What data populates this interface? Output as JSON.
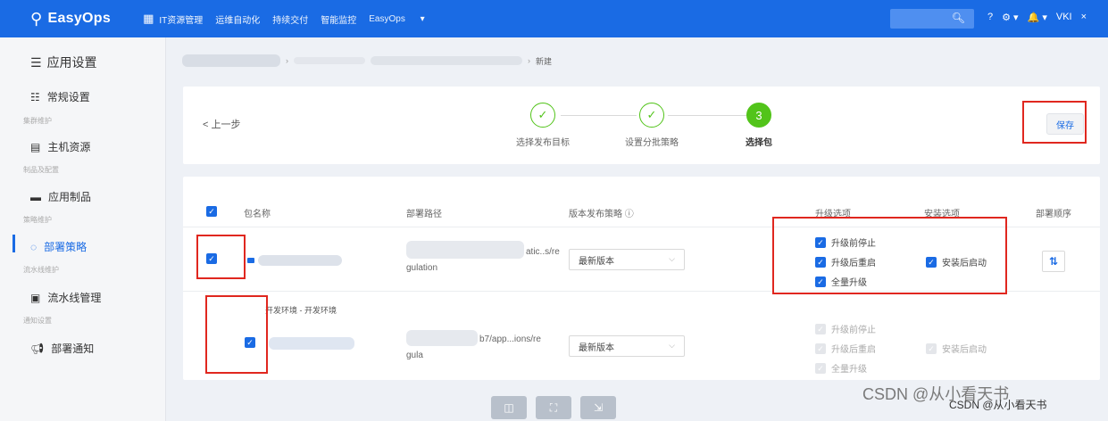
{
  "topbar": {
    "logo": "EasyOps",
    "nav": [
      "IT资源管理",
      "运维自动化",
      "持续交付",
      "智能监控",
      "EasyOps"
    ],
    "tools": [
      "?",
      "⚙",
      "🔔",
      "VKI",
      "×"
    ]
  },
  "sidebar": {
    "title": "应用设置",
    "items": [
      {
        "label": "常规设置",
        "sub": "集群维护"
      },
      {
        "label": "主机资源",
        "sub": "制品及配置"
      },
      {
        "label": "应用制品",
        "sub": "策略维护"
      },
      {
        "label": "部署策略",
        "sub": "流水线维护"
      },
      {
        "label": "流水线管理",
        "sub": "通知设置"
      },
      {
        "label": "部署通知",
        "sub": ""
      }
    ]
  },
  "breadcrumb": {
    "current": "新建"
  },
  "steps": {
    "prev_label": "< 上一步",
    "items": [
      {
        "label": "选择发布目标",
        "mark": "✓"
      },
      {
        "label": "设置分批策略",
        "mark": "✓"
      },
      {
        "label": "选择包",
        "mark": "3"
      }
    ],
    "save_label": "保存"
  },
  "table": {
    "headers": [
      "包名称",
      "部署路径",
      "版本发布策略 ⓘ",
      "升级选项",
      "安装选项",
      "部署顺序"
    ],
    "rows": [
      {
        "path_line1": "atic..s/re",
        "path_line2": "gulation",
        "version": "最新版本",
        "upgrade": [
          "升级前停止",
          "升级后重启",
          "全量升级"
        ],
        "install": "安装后启动",
        "order_icon": "⇅"
      },
      {
        "env": "开发环境 - 开发环境",
        "path_line1": "b7/app...ions/re",
        "path_line2": "gula",
        "version": "最新版本",
        "upgrade": [
          "升级前停止",
          "升级后重启",
          "全量升级"
        ],
        "install": "安装后启动"
      }
    ]
  },
  "watermark": {
    "main": "CSDN @从小看天书",
    "small": "CSDN @从小看天书"
  }
}
